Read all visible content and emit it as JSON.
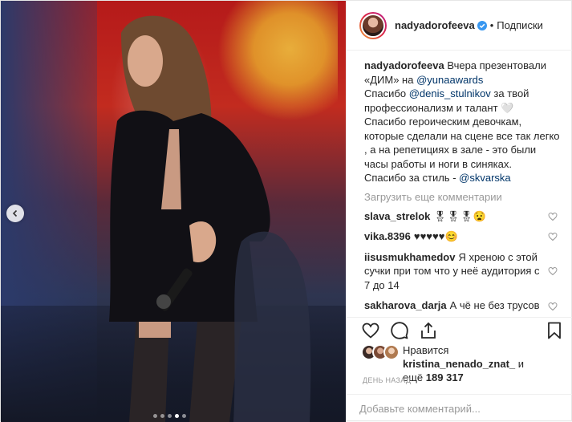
{
  "header": {
    "username": "nadyadorofeeva",
    "separator": "•",
    "follow_label": "Подписки"
  },
  "caption": {
    "username": "nadyadorofeeva",
    "line1": "Вчера презентовали «ДИМ» на ",
    "mention1": "@yunaawards",
    "line2": "Спасибо ",
    "mention2": "@denis_stulnikov",
    "line3": " за твой профессионализм и талант 🤍",
    "line4": "Спасибо героическим девочкам, которые сделали на сцене все так легко , а на репетициях в зале - это были часы работы и ноги в синяках.",
    "line5": "Спасибо за стиль - ",
    "mention3": "@skvarska"
  },
  "load_more_label": "Загрузить еще комментарии",
  "comments": [
    {
      "user": "slava_strelok",
      "text": "🎖🎖🎖😧"
    },
    {
      "user": "vika.8396",
      "text": "♥♥♥♥♥😊"
    },
    {
      "user": "iisusmukhamedov",
      "text": "Я хреною с этой сучки при том что у неё аудитория с 7 до 14"
    },
    {
      "user": "sakharova_darja",
      "text": "А чё не без трусов то сразу вышла,фу позорище"
    }
  ],
  "likes": {
    "prefix": "Нравится ",
    "user": "kristina_nenado_znat_",
    "suffix": " и",
    "more_prefix": "ещё ",
    "more_count": "189 317"
  },
  "time_label": "день назад",
  "add_comment": {
    "placeholder": "Добавьте комментарий..."
  },
  "carousel": {
    "total": 5,
    "active": 4
  },
  "colors": {
    "link": "#003569",
    "muted": "#999999",
    "verified": "#3897f0"
  },
  "icons": [
    "chevron-left-icon",
    "verified-icon",
    "heart-icon",
    "comment-icon",
    "share-icon",
    "bookmark-icon"
  ]
}
